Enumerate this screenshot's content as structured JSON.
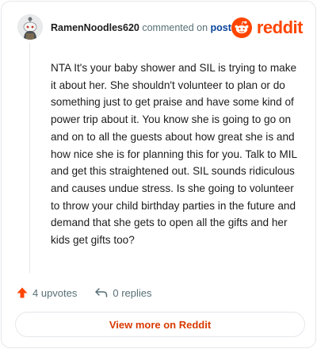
{
  "comment": {
    "author": "RamenNoodles620",
    "action_text": "commented on",
    "post_link": "post",
    "body": "NTA It's your baby shower and SIL is trying to make it about her. She shouldn't volunteer to plan or do something just to get praise and have some kind of power trip about it. You know she is going to go on and on to all the guests about how great she is and how nice she is for planning this for you. Talk to MIL and get this straightened out. SIL sounds ridiculous and causes undue stress. Is she going to volunteer to throw your child birthday parties in the future and demand that she gets to open all the gifts and her kids get gifts too?"
  },
  "brand": {
    "name": "reddit",
    "icon": "reddit-logo-icon",
    "color": "#ff4500"
  },
  "actions": {
    "upvotes": "4 upvotes",
    "upvote_icon": "upvote-arrow-icon",
    "replies": "0 replies",
    "reply_icon": "reply-arrow-icon"
  },
  "footer": {
    "view_more": "View more on Reddit"
  },
  "colors": {
    "accent": "#d93a00",
    "upvote": "#ff4500",
    "link": "#0a449b",
    "muted": "#576f76"
  }
}
